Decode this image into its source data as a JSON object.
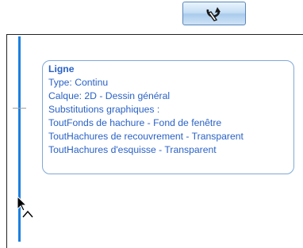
{
  "toolbar": {
    "icon": "rotate-icon",
    "accent": "#1d7fe0"
  },
  "canvas": {
    "line_color": "#1d7fe0"
  },
  "tooltip": {
    "title": "Ligne",
    "type_line": "Type: Continu",
    "layer_line": "Calque: 2D -  Dessin général",
    "substitutions_header": "Substitutions graphiques :",
    "substitutions": [
      "ToutFonds de hachure  - Fond de fenêtre",
      "ToutHachures de recouvrement - Transparent",
      "ToutHachures d'esquisse - Transparent"
    ],
    "text_color": "#2a62c6",
    "border_color": "#7fa8d6"
  }
}
